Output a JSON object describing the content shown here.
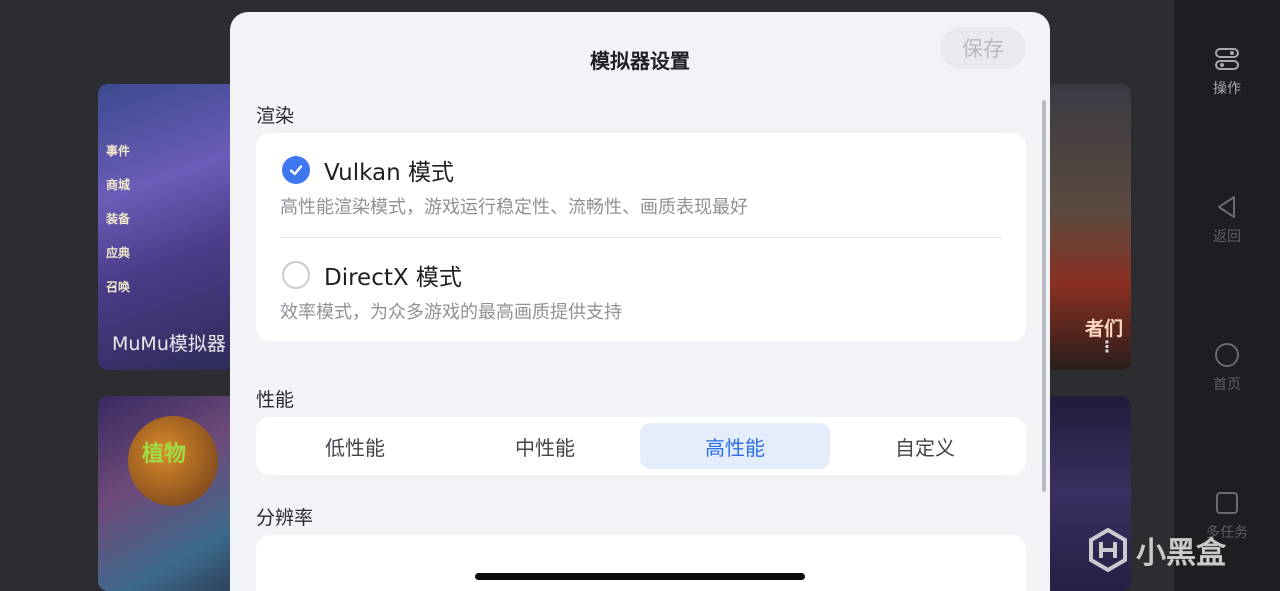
{
  "background": {
    "card_caption": "MuMu模拟器",
    "card_menu": [
      "事件",
      "商城",
      "装备",
      "应典",
      "召唤"
    ],
    "card_bottom_title": "植物",
    "card_right_tag": "者们",
    "card_more": "⋮"
  },
  "right_nav": {
    "items": [
      {
        "label": "操作",
        "icon": "toggle-icon"
      },
      {
        "label": "返回",
        "icon": "back-triangle-icon"
      },
      {
        "label": "首页",
        "icon": "home-circle-icon"
      },
      {
        "label": "多任务",
        "icon": "recents-square-icon"
      }
    ]
  },
  "watermark": {
    "text": "小黑盒"
  },
  "modal": {
    "title": "模拟器设置",
    "save_label": "保存",
    "render": {
      "label": "渲染",
      "options": [
        {
          "title": "Vulkan 模式",
          "desc": "高性能渲染模式，游戏运行稳定性、流畅性、画质表现最好",
          "checked": true
        },
        {
          "title": "DirectX 模式",
          "desc": "效率模式，为众多游戏的最高画质提供支持",
          "checked": false
        }
      ]
    },
    "performance": {
      "label": "性能",
      "options": [
        "低性能",
        "中性能",
        "高性能",
        "自定义"
      ],
      "selected": "高性能"
    },
    "resolution": {
      "label": "分辨率"
    }
  },
  "colors": {
    "accent": "#3f77f0",
    "selected_bg": "#e3edfc",
    "selected_text": "#2f6de6"
  }
}
